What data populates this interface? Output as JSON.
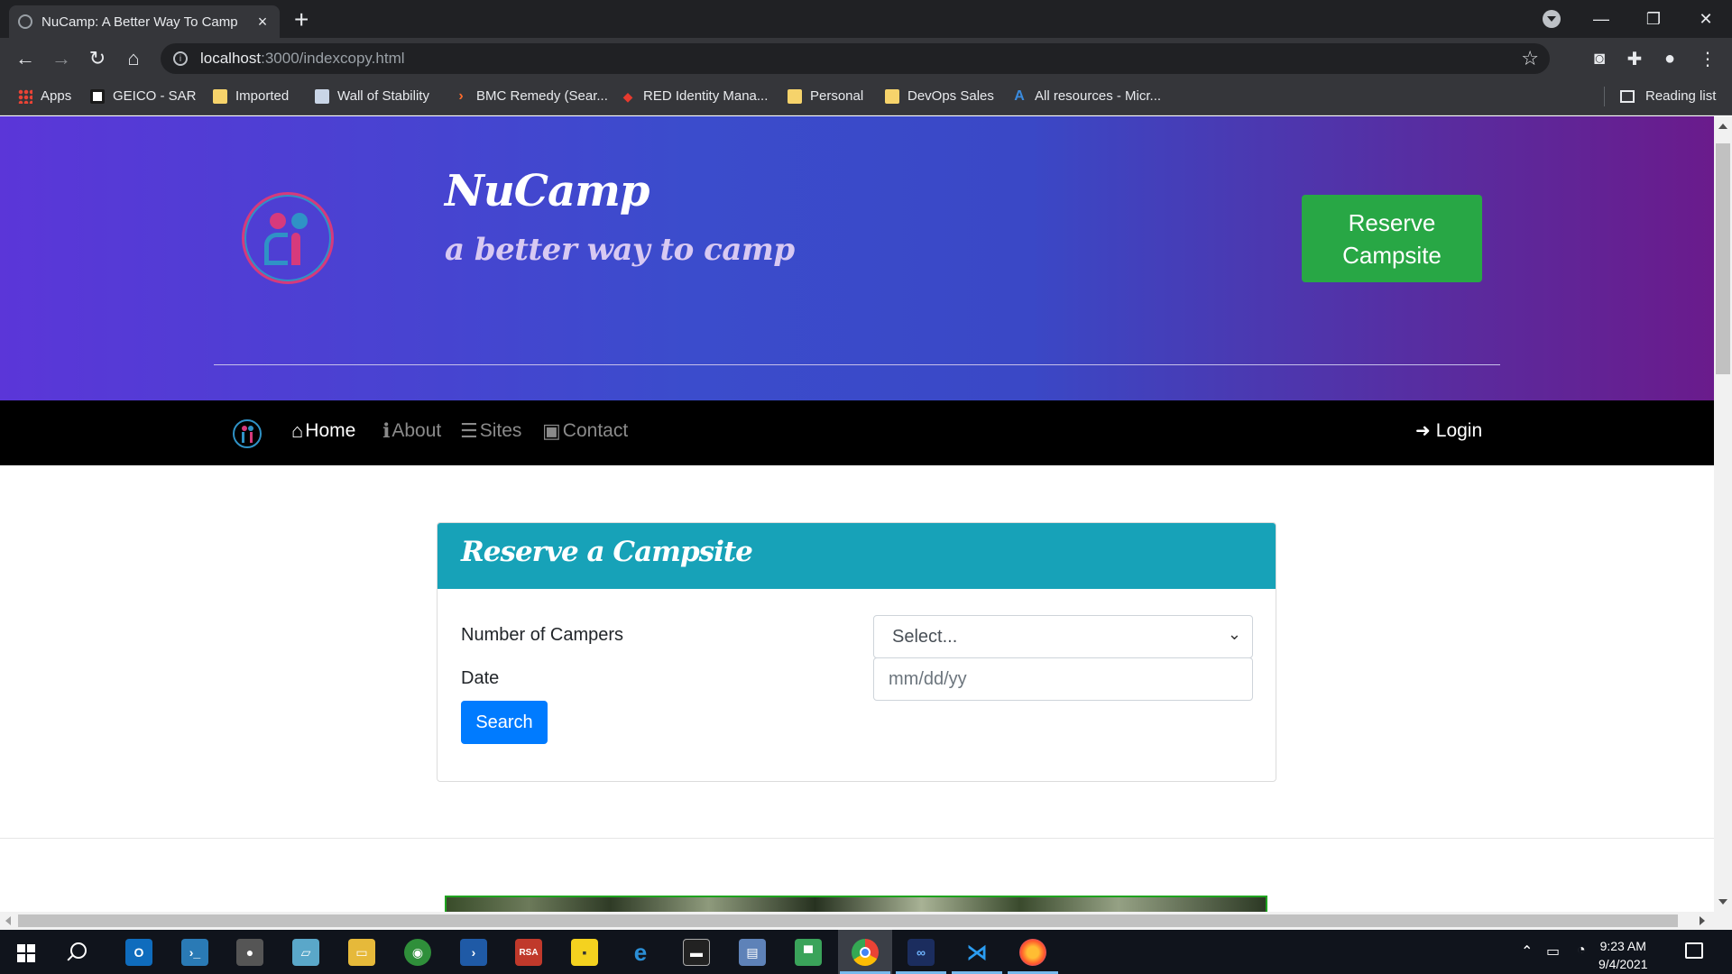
{
  "browser": {
    "tab_title": "NuCamp: A Better Way To Camp",
    "new_tab": "+",
    "url_host": "localhost",
    "url_path": ":3000/indexcopy.html",
    "bookmarks": [
      {
        "label": "Apps",
        "icon": "apps-grid-icon"
      },
      {
        "label": "GEICO - SAR",
        "icon": "geico-icon"
      },
      {
        "label": "Imported",
        "icon": "folder-icon"
      },
      {
        "label": "Wall of Stability",
        "icon": "page-icon"
      },
      {
        "label": "BMC Remedy (Sear...",
        "icon": "bmc-icon"
      },
      {
        "label": "RED Identity Mana...",
        "icon": "red-identity-icon"
      },
      {
        "label": "Personal",
        "icon": "folder-icon"
      },
      {
        "label": "DevOps Sales",
        "icon": "folder-icon"
      },
      {
        "label": "All resources - Micr...",
        "icon": "azure-icon"
      }
    ],
    "reading_list": "Reading list"
  },
  "header": {
    "title": "NuCamp",
    "subtitle": "a better way to camp",
    "reserve_button": "Reserve Campsite"
  },
  "nav": {
    "items": [
      {
        "label": "Home",
        "icon": "home-icon"
      },
      {
        "label": "About",
        "icon": "info-icon"
      },
      {
        "label": "Sites",
        "icon": "list-icon"
      },
      {
        "label": "Contact",
        "icon": "address-card-icon"
      }
    ],
    "login": "Login"
  },
  "reserve_form": {
    "title": "Reserve a Campsite",
    "campers_label": "Number of Campers",
    "campers_value": "Select...",
    "date_label": "Date",
    "date_placeholder": "mm/dd/yy",
    "search_button": "Search"
  },
  "taskbar": {
    "time": "9:23 AM",
    "date": "9/4/2021"
  },
  "colors": {
    "jumbotron_start": "#5b36d8",
    "jumbotron_end": "#6a1b8c",
    "reserve_button": "#28a745",
    "card_header": "#17a2b8",
    "search_button": "#007bff"
  }
}
